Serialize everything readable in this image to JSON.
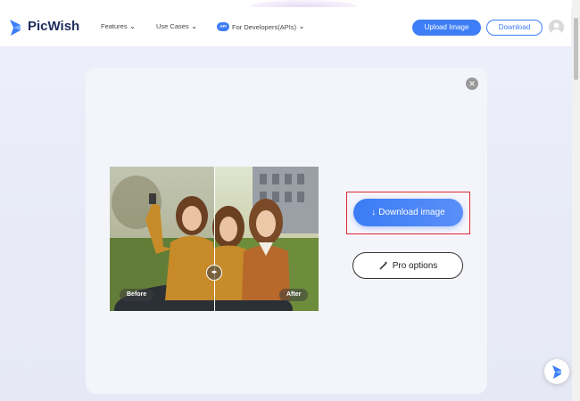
{
  "brand": {
    "name": "PicWish"
  },
  "nav": {
    "features": "Features",
    "use_cases": "Use Cases",
    "api_badge": "API",
    "developers": "For Developers(APIs)"
  },
  "header_actions": {
    "upload_image": "Upload Image",
    "download": "Download"
  },
  "preview": {
    "before_label": "Before",
    "after_label": "After"
  },
  "actions": {
    "download_image": "Download image",
    "pro_options": "Pro options"
  },
  "icons": {
    "close": "close-icon",
    "download_arrow": "arrow-down-icon",
    "pro": "magic-wand-icon",
    "chevron": "chevron-down-icon",
    "avatar": "user-avatar-icon",
    "compare_handle": "left-right-arrows-icon"
  },
  "colors": {
    "accent": "#3d7ef6",
    "highlight": "#e0282e",
    "brand_text": "#1f2d5c"
  }
}
